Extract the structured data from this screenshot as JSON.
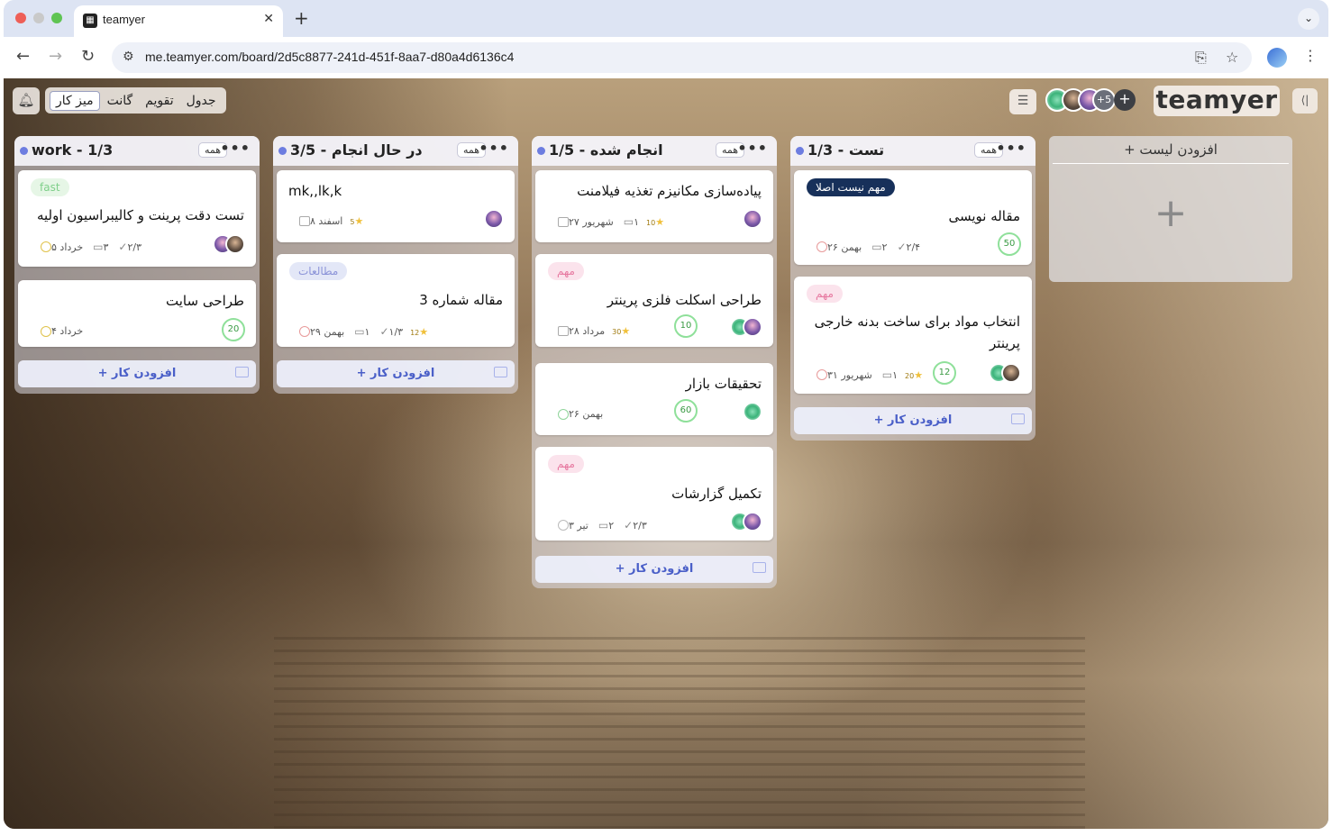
{
  "browser": {
    "tab_title": "teamyer",
    "favicon": "teamyer-favicon",
    "url": "me.teamyer.com/board/2d5c8877-241d-451f-8aa7-d80a4d6136c4"
  },
  "header": {
    "views": [
      "جدول",
      "تقویم",
      "گانت",
      "میز کار"
    ],
    "active_view": "میز کار",
    "logo": "teamyer",
    "members_more": "+5"
  },
  "columns": [
    {
      "title": "work - 1/3",
      "all_label": "همه",
      "cards": [
        {
          "label": "fast",
          "label_style": "fast",
          "title": "تست دقت پرینت و کالیبراسیون اولیه",
          "date": "خرداد ۵",
          "comments": "۳",
          "checklist": "۲/۳",
          "avatars": [
            "purple",
            "person"
          ]
        },
        {
          "title": "طراحی سایت",
          "date": "خرداد ۴",
          "progress": "20"
        }
      ],
      "add_label": "+ افزودن کار"
    },
    {
      "title": "در حال انجام - 3/5",
      "all_label": "همه",
      "cards": [
        {
          "title": "mk,,lk,k",
          "date": "اسفند ۸",
          "star": "5",
          "avatars": [
            "purple"
          ]
        },
        {
          "label": "مطالعات",
          "label_style": "study",
          "title": "مقاله شماره 3",
          "date": "بهمن ۲۹",
          "comments": "۱",
          "checklist": "۱/۳",
          "star": "12"
        }
      ],
      "add_label": "+ افزودن کار"
    },
    {
      "title": "انجام شده - 1/5",
      "all_label": "همه",
      "cards": [
        {
          "title": "پیاده‌سازی مکانیزم تغذیه فیلامنت",
          "date": "شهریور ۲۷",
          "comments": "۱",
          "star": "10",
          "avatars": [
            "purple"
          ]
        },
        {
          "label": "مهم",
          "label_style": "important",
          "title": "طراحی اسکلت فلزی پرینتر",
          "date": "مرداد ۲۸",
          "star": "30",
          "progress": "10",
          "avatars": [
            "green",
            "purple"
          ]
        },
        {
          "title": "تحقیقات بازار",
          "date": "بهمن ۲۶",
          "progress": "60",
          "avatars": [
            "green"
          ]
        },
        {
          "label": "مهم",
          "label_style": "important",
          "title": "تکمیل گزارشات",
          "date": "تیر ۳",
          "comments": "۲",
          "checklist": "۲/۳",
          "avatars": [
            "green",
            "purple"
          ]
        }
      ],
      "add_label": "+ افزودن کار"
    },
    {
      "title": "تست - 1/3",
      "all_label": "همه",
      "cards": [
        {
          "label": "مهم نیست اصلا",
          "label_style": "dark",
          "title": "مقاله نویسی",
          "date": "بهمن ۲۶",
          "comments": "۲",
          "checklist": "۲/۴",
          "progress": "50"
        },
        {
          "label": "مهم",
          "label_style": "important",
          "title": "انتخاب مواد برای ساخت بدنه خارجی پرینتر",
          "date": "شهریور ۳۱",
          "comments": "۱",
          "star": "20",
          "progress": "12",
          "avatars": [
            "green",
            "person"
          ]
        }
      ],
      "add_label": "+ افزودن کار"
    }
  ],
  "add_list_label": "+ افزودن لیست",
  "colors": {
    "accent": "#4a5fc8",
    "dot": "#6d7de0"
  }
}
